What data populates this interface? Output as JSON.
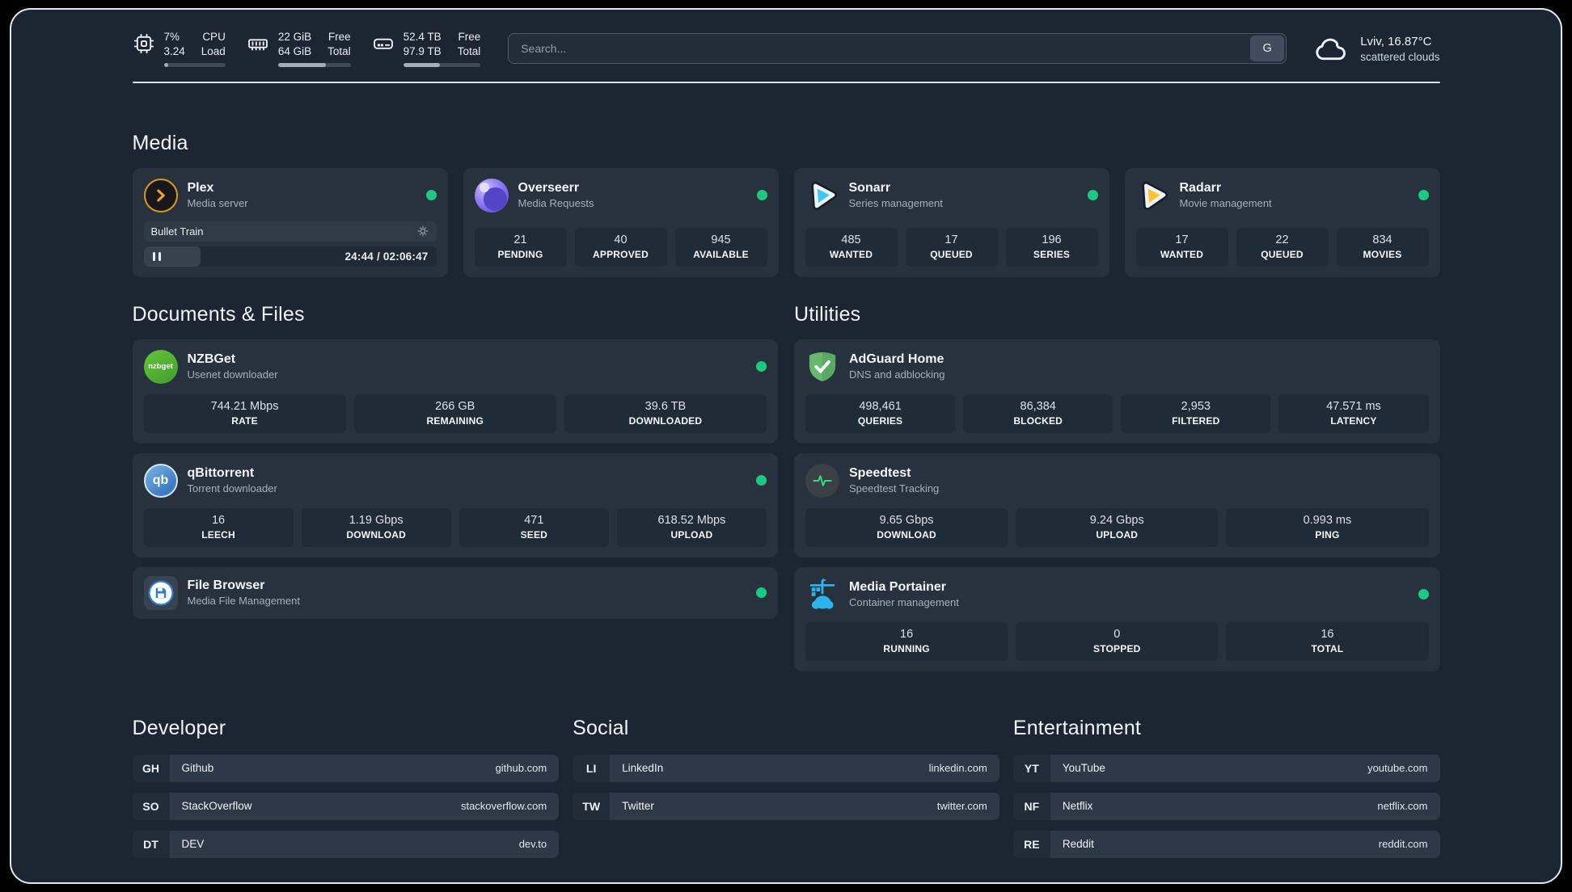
{
  "colors": {
    "background": "#1c2633",
    "card": "#28323f",
    "tile": "#202b38",
    "status_online": "#1dc97e",
    "plex_amber": "#d99a14",
    "sonarr_blue": "#3fc6f4",
    "radarr_yellow": "#ffc230",
    "adguard_green": "#63b56a",
    "portainer_blue": "#2cb4ee"
  },
  "topbar": {
    "cpu": {
      "icon": "cpu-chip-icon",
      "value_top": "7%",
      "value_bottom": "3.24",
      "label_top": "CPU",
      "label_bottom": "Load",
      "progress_pct": 7
    },
    "memory": {
      "icon": "ram-icon",
      "value_top": "22 GiB",
      "value_bottom": "64 GiB",
      "label_top": "Free",
      "label_bottom": "Total",
      "progress_pct": 66
    },
    "storage": {
      "icon": "hard-drive-icon",
      "value_top": "52.4 TB",
      "value_bottom": "97.9 TB",
      "label_top": "Free",
      "label_bottom": "Total",
      "progress_pct": 47
    },
    "search": {
      "placeholder": "Search...",
      "button_label": "G"
    },
    "weather": {
      "icon": "cloud-icon",
      "location_temp": "Lviv, 16.87°C",
      "condition": "scattered clouds"
    }
  },
  "sections": {
    "media": {
      "title": "Media",
      "cards": [
        {
          "name": "Plex",
          "subtitle": "Media server",
          "icon": "plex-icon",
          "online": true,
          "player": {
            "title": "Bullet Train",
            "time": "24:44 / 02:06:47",
            "progress_pct": 19.5
          }
        },
        {
          "name": "Overseerr",
          "subtitle": "Media Requests",
          "icon": "overseerr-icon",
          "online": true,
          "stats": [
            {
              "value": "21",
              "label": "PENDING"
            },
            {
              "value": "40",
              "label": "APPROVED"
            },
            {
              "value": "945",
              "label": "AVAILABLE"
            }
          ]
        },
        {
          "name": "Sonarr",
          "subtitle": "Series management",
          "icon": "sonarr-icon",
          "online": true,
          "stats": [
            {
              "value": "485",
              "label": "WANTED"
            },
            {
              "value": "17",
              "label": "QUEUED"
            },
            {
              "value": "196",
              "label": "SERIES"
            }
          ]
        },
        {
          "name": "Radarr",
          "subtitle": "Movie management",
          "icon": "radarr-icon",
          "online": true,
          "stats": [
            {
              "value": "17",
              "label": "WANTED"
            },
            {
              "value": "22",
              "label": "QUEUED"
            },
            {
              "value": "834",
              "label": "MOVIES"
            }
          ]
        }
      ]
    },
    "documents": {
      "title": "Documents & Files",
      "cards": [
        {
          "name": "NZBGet",
          "subtitle": "Usenet downloader",
          "icon": "nzbget-icon",
          "icon_text": "nzbget",
          "online": true,
          "stats": [
            {
              "value": "744.21 Mbps",
              "label": "RATE"
            },
            {
              "value": "266 GB",
              "label": "REMAINING"
            },
            {
              "value": "39.6 TB",
              "label": "DOWNLOADED"
            }
          ]
        },
        {
          "name": "qBittorrent",
          "subtitle": "Torrent downloader",
          "icon": "qbittorrent-icon",
          "icon_text": "qb",
          "online": true,
          "stats": [
            {
              "value": "16",
              "label": "LEECH"
            },
            {
              "value": "1.19 Gbps",
              "label": "DOWNLOAD"
            },
            {
              "value": "471",
              "label": "SEED"
            },
            {
              "value": "618.52 Mbps",
              "label": "UPLOAD"
            }
          ]
        },
        {
          "name": "File Browser",
          "subtitle": "Media File Management",
          "icon": "filebrowser-icon",
          "online": true
        }
      ]
    },
    "utilities": {
      "title": "Utilities",
      "cards": [
        {
          "name": "AdGuard Home",
          "subtitle": "DNS and adblocking",
          "icon": "adguard-icon",
          "online": false,
          "stats": [
            {
              "value": "498,461",
              "label": "QUERIES"
            },
            {
              "value": "86,384",
              "label": "BLOCKED"
            },
            {
              "value": "2,953",
              "label": "FILTERED"
            },
            {
              "value": "47.571 ms",
              "label": "LATENCY"
            }
          ]
        },
        {
          "name": "Speedtest",
          "subtitle": "Speedtest Tracking",
          "icon": "speedtest-icon",
          "online": false,
          "stats": [
            {
              "value": "9.65 Gbps",
              "label": "DOWNLOAD"
            },
            {
              "value": "9.24 Gbps",
              "label": "UPLOAD"
            },
            {
              "value": "0.993 ms",
              "label": "PING"
            }
          ]
        },
        {
          "name": "Media Portainer",
          "subtitle": "Container management",
          "icon": "portainer-icon",
          "online": true,
          "stats": [
            {
              "value": "16",
              "label": "RUNNING"
            },
            {
              "value": "0",
              "label": "STOPPED"
            },
            {
              "value": "16",
              "label": "TOTAL"
            }
          ]
        }
      ]
    },
    "developer": {
      "title": "Developer",
      "links": [
        {
          "abbr": "GH",
          "name": "Github",
          "url": "github.com"
        },
        {
          "abbr": "SO",
          "name": "StackOverflow",
          "url": "stackoverflow.com"
        },
        {
          "abbr": "DT",
          "name": "DEV",
          "url": "dev.to"
        }
      ]
    },
    "social": {
      "title": "Social",
      "links": [
        {
          "abbr": "LI",
          "name": "LinkedIn",
          "url": "linkedin.com"
        },
        {
          "abbr": "TW",
          "name": "Twitter",
          "url": "twitter.com"
        }
      ]
    },
    "entertainment": {
      "title": "Entertainment",
      "links": [
        {
          "abbr": "YT",
          "name": "YouTube",
          "url": "youtube.com"
        },
        {
          "abbr": "NF",
          "name": "Netflix",
          "url": "netflix.com"
        },
        {
          "abbr": "RE",
          "name": "Reddit",
          "url": "reddit.com"
        }
      ]
    }
  }
}
